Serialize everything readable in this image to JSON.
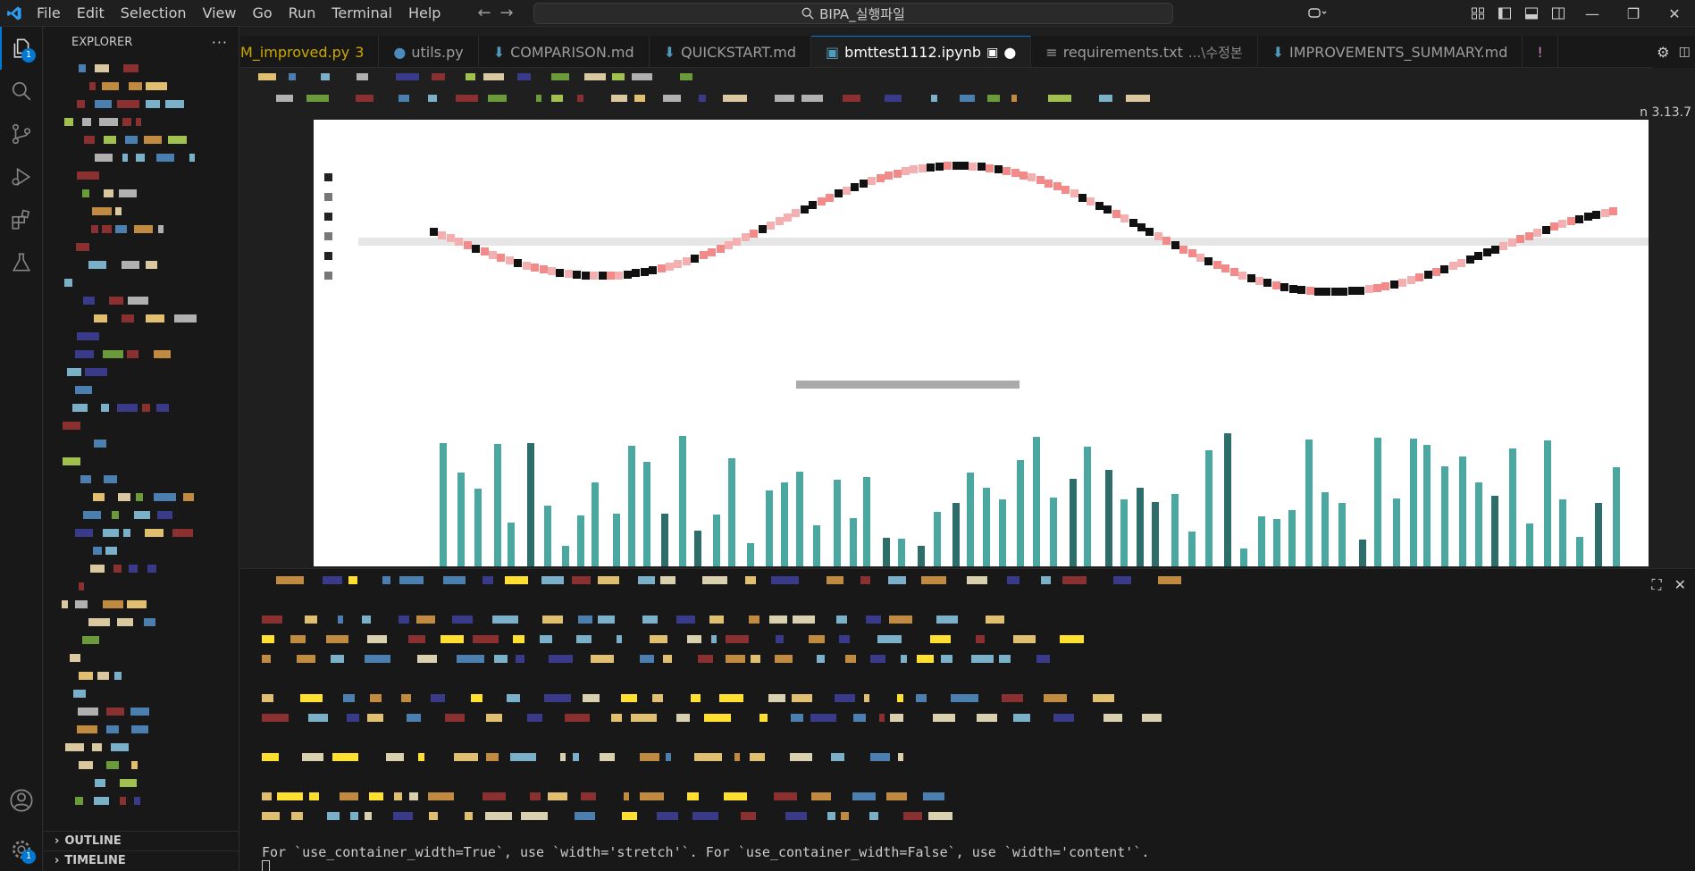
{
  "menu": [
    "File",
    "Edit",
    "Selection",
    "View",
    "Go",
    "Run",
    "Terminal",
    "Help"
  ],
  "search": {
    "text": "BIPA_실행파일"
  },
  "activity": {
    "explorer_badge": "1",
    "settings_badge": "1"
  },
  "sidebar": {
    "title": "EXPLORER",
    "more": "···",
    "outline": "OUTLINE",
    "timeline": "TIMELINE"
  },
  "tabs": [
    {
      "label": "M_improved.py",
      "extra": "3",
      "icon": "python-icon"
    },
    {
      "label": "utils.py",
      "extra": "",
      "icon": "python-icon"
    },
    {
      "label": "COMPARISON.md",
      "extra": "",
      "icon": "markdown-icon"
    },
    {
      "label": "QUICKSTART.md",
      "extra": "",
      "icon": "markdown-icon"
    },
    {
      "label": "bmttest1112.ipynb",
      "extra": "",
      "icon": "notebook-icon"
    },
    {
      "label": "requirements.txt",
      "extra": "...\\수정본",
      "icon": "text-file-icon"
    },
    {
      "label": "IMPROVEMENTS_SUMMARY.md",
      "extra": "",
      "icon": "markdown-icon"
    }
  ],
  "editor": {
    "kernel_label": "n 3.13.7"
  },
  "terminal": {
    "warning_line": "For `use_container_width=True`, use `width='stretch'`. For `use_container_width=False`, use `width='content'`."
  },
  "colors": {
    "accent": "#0078d4",
    "warning": "#cca700",
    "line_series": "#f28a8a",
    "bar_series": "#4aa8a0"
  }
}
